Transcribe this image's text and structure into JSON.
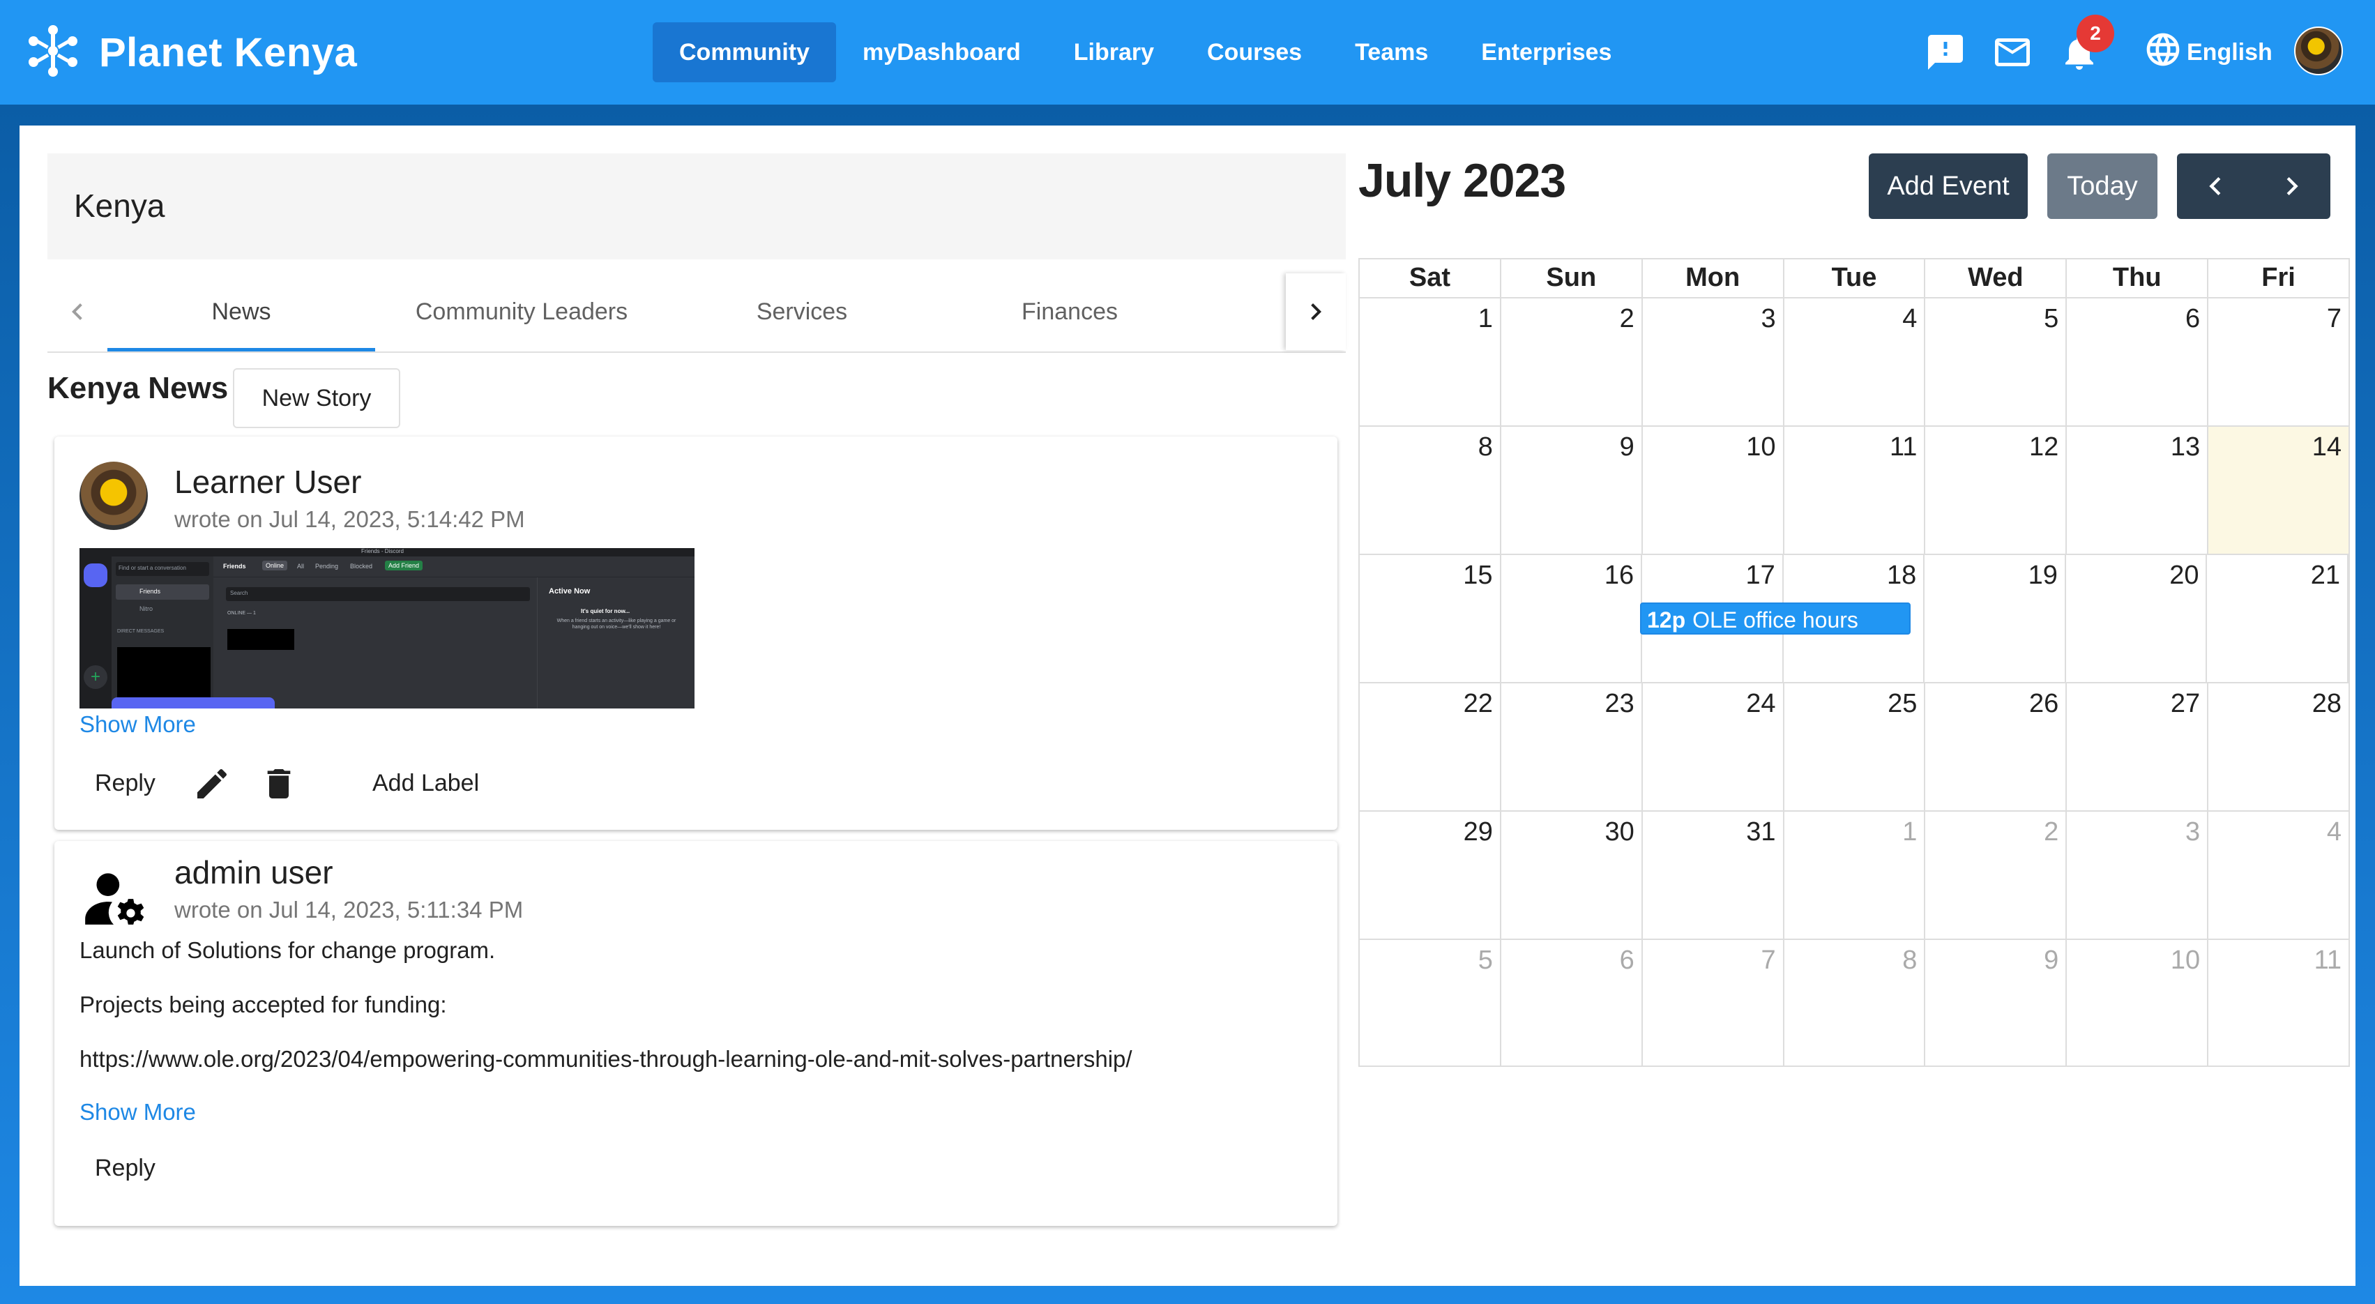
{
  "app": {
    "name": "Planet Kenya"
  },
  "nav": [
    "Community",
    "myDashboard",
    "Library",
    "Courses",
    "Teams",
    "Enterprises"
  ],
  "header_icons": {
    "feedback": "feedback-icon",
    "mail": "mail-icon",
    "notifications": "bell-icon",
    "notification_count": "2",
    "language_icon": "globe-icon",
    "language": "English"
  },
  "community": {
    "title": "Kenya",
    "tabs": [
      "News",
      "Community Leaders",
      "Services",
      "Finances"
    ],
    "active_tab": "News",
    "news_heading": "Kenya News",
    "new_story_label": "New Story"
  },
  "posts": [
    {
      "author": "Learner User",
      "date": "wrote on Jul 14, 2023, 5:14:42 PM",
      "show_more": "Show More",
      "reply": "Reply",
      "add_label": "Add Label"
    },
    {
      "author": "admin user",
      "date": "wrote on Jul 14, 2023, 5:11:34 PM",
      "lines": [
        "Launch of Solutions for change program.",
        "Projects being accepted for funding:",
        "https://www.ole.org/2023/04/empowering-communities-through-learning-ole-and-mit-solves-partnership/"
      ],
      "show_more": "Show More",
      "reply": "Reply"
    }
  ],
  "screenshot_in_post": {
    "title": "Friends - Discord",
    "search_placeholder": "Find or start a conversation",
    "tab_friends": "Friends",
    "tab_online": "Online",
    "tab_all": "All",
    "tab_pending": "Pending",
    "tab_blocked": "Blocked",
    "tab_add_friend": "Add Friend",
    "side_friends": "Friends",
    "side_nitro": "Nitro",
    "direct_messages": "DIRECT MESSAGES",
    "search": "Search",
    "online_count": "ONLINE — 1",
    "active_now": "Active Now",
    "quiet_title": "It's quiet for now...",
    "quiet_text": "When a friend starts an activity—like playing a game or hanging out on voice—we'll show it here!"
  },
  "calendar": {
    "month_title": "July 2023",
    "add_event": "Add Event",
    "today": "Today",
    "weekdays": [
      "Sat",
      "Sun",
      "Mon",
      "Tue",
      "Wed",
      "Thu",
      "Fri"
    ],
    "weeks": [
      [
        "1",
        "2",
        "3",
        "4",
        "5",
        "6",
        "7"
      ],
      [
        "8",
        "9",
        "10",
        "11",
        "12",
        "13",
        "14"
      ],
      [
        "15",
        "16",
        "17",
        "18",
        "19",
        "20",
        "21"
      ],
      [
        "22",
        "23",
        "24",
        "25",
        "26",
        "27",
        "28"
      ],
      [
        "29",
        "30",
        "31",
        "1",
        "2",
        "3",
        "4"
      ],
      [
        "5",
        "6",
        "7",
        "8",
        "9",
        "10",
        "11"
      ]
    ],
    "today_date": "14",
    "event": {
      "time": "12p",
      "title": "OLE office hours",
      "days": [
        "17",
        "18"
      ]
    }
  },
  "colors": {
    "primary": "#2196f3",
    "primary_dark": "#1976d2",
    "dark_button": "#2c3e50",
    "today_button": "#6c7a89",
    "today_cell": "#fcf8e3",
    "badge": "#e53935",
    "link": "#1e88e5"
  }
}
